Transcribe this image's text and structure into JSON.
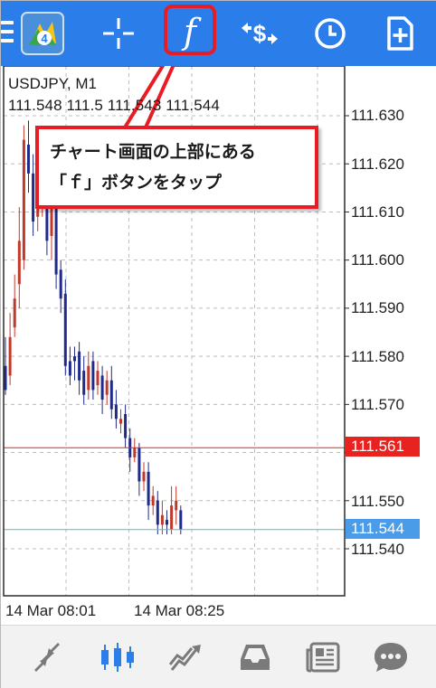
{
  "toolbar": {
    "buttons": [
      {
        "name": "menu-icon"
      },
      {
        "name": "metatrader-logo-icon"
      },
      {
        "name": "crosshair-icon"
      },
      {
        "name": "indicator-f-icon",
        "glyph": "f",
        "highlighted": true
      },
      {
        "name": "trade-icon"
      },
      {
        "name": "history-clock-icon"
      },
      {
        "name": "new-document-icon"
      }
    ],
    "background_color": "#2b7de9"
  },
  "chart": {
    "symbol": "USDJPY, M1",
    "ohlc": "111.548 111.5   111.543 111.544",
    "price_axis": [
      "111.630",
      "111.620",
      "111.610",
      "111.600",
      "111.590",
      "111.580",
      "111.570",
      "111.550",
      "111.540"
    ],
    "bid_tag": {
      "value": "111.561",
      "color": "#e8231f"
    },
    "ask_tag": {
      "value": "111.544",
      "color": "#4a9be8"
    },
    "time_axis": [
      "14 Mar 08:01",
      "14 Mar 08:25"
    ]
  },
  "callout": {
    "line1": "チャート画面の上部にある",
    "line2": "「ｆ」ボタンをタップ",
    "border_color": "#e81c24"
  },
  "chart_data": {
    "type": "candlestick",
    "symbol": "USDJPY",
    "timeframe": "M1",
    "ylim": [
      111.535,
      111.635
    ],
    "candles": [
      {
        "o": 111.578,
        "c": 111.573,
        "h": 111.584,
        "l": 111.572
      },
      {
        "o": 111.576,
        "c": 111.584,
        "h": 111.589,
        "l": 111.574
      },
      {
        "o": 111.586,
        "c": 111.592,
        "h": 111.597,
        "l": 111.584
      },
      {
        "o": 111.595,
        "c": 111.604,
        "h": 111.611,
        "l": 111.59
      },
      {
        "o": 111.6,
        "c": 111.625,
        "h": 111.628,
        "l": 111.598
      },
      {
        "o": 111.624,
        "c": 111.618,
        "h": 111.629,
        "l": 111.614
      },
      {
        "o": 111.618,
        "c": 111.608,
        "h": 111.622,
        "l": 111.605
      },
      {
        "o": 111.609,
        "c": 111.611,
        "h": 111.616,
        "l": 111.606
      },
      {
        "o": 111.612,
        "c": 111.614,
        "h": 111.618,
        "l": 111.609
      },
      {
        "o": 111.614,
        "c": 111.604,
        "h": 111.618,
        "l": 111.601
      },
      {
        "o": 111.605,
        "c": 111.612,
        "h": 111.615,
        "l": 111.6
      },
      {
        "o": 111.613,
        "c": 111.597,
        "h": 111.616,
        "l": 111.594
      },
      {
        "o": 111.598,
        "c": 111.592,
        "h": 111.6,
        "l": 111.589
      },
      {
        "o": 111.593,
        "c": 111.578,
        "h": 111.596,
        "l": 111.576
      },
      {
        "o": 111.579,
        "c": 111.576,
        "h": 111.582,
        "l": 111.574
      },
      {
        "o": 111.58,
        "c": 111.579,
        "h": 111.582,
        "l": 111.575
      },
      {
        "o": 111.581,
        "c": 111.575,
        "h": 111.583,
        "l": 111.572
      },
      {
        "o": 111.577,
        "c": 111.572,
        "h": 111.58,
        "l": 111.57
      },
      {
        "o": 111.573,
        "c": 111.578,
        "h": 111.581,
        "l": 111.571
      },
      {
        "o": 111.579,
        "c": 111.573,
        "h": 111.581,
        "l": 111.571
      },
      {
        "o": 111.574,
        "c": 111.577,
        "h": 111.579,
        "l": 111.572
      },
      {
        "o": 111.576,
        "c": 111.571,
        "h": 111.578,
        "l": 111.568
      },
      {
        "o": 111.572,
        "c": 111.575,
        "h": 111.577,
        "l": 111.57
      },
      {
        "o": 111.575,
        "c": 111.569,
        "h": 111.578,
        "l": 111.567
      },
      {
        "o": 111.57,
        "c": 111.567,
        "h": 111.573,
        "l": 111.565
      },
      {
        "o": 111.566,
        "c": 111.567,
        "h": 111.569,
        "l": 111.564
      },
      {
        "o": 111.568,
        "c": 111.563,
        "h": 111.57,
        "l": 111.561
      },
      {
        "o": 111.563,
        "c": 111.559,
        "h": 111.565,
        "l": 111.556
      },
      {
        "o": 111.559,
        "c": 111.561,
        "h": 111.563,
        "l": 111.558
      },
      {
        "o": 111.561,
        "c": 111.554,
        "h": 111.562,
        "l": 111.551
      },
      {
        "o": 111.554,
        "c": 111.556,
        "h": 111.558,
        "l": 111.552
      },
      {
        "o": 111.556,
        "c": 111.549,
        "h": 111.558,
        "l": 111.546
      },
      {
        "o": 111.549,
        "c": 111.551,
        "h": 111.553,
        "l": 111.547
      },
      {
        "o": 111.55,
        "c": 111.545,
        "h": 111.552,
        "l": 111.543
      },
      {
        "o": 111.545,
        "c": 111.547,
        "h": 111.55,
        "l": 111.543
      },
      {
        "o": 111.546,
        "c": 111.545,
        "h": 111.548,
        "l": 111.543
      },
      {
        "o": 111.544,
        "c": 111.549,
        "h": 111.553,
        "l": 111.543
      },
      {
        "o": 111.548,
        "c": 111.55,
        "h": 111.553,
        "l": 111.545
      },
      {
        "o": 111.548,
        "c": 111.544,
        "h": 111.549,
        "l": 111.543
      }
    ],
    "bid_line": 111.561,
    "ask_line": 111.544,
    "bull_color": "#c0392b",
    "bear_color": "#1f2a8a",
    "grid": true
  },
  "bottom_nav": {
    "items": [
      {
        "name": "quotes-arrows-icon"
      },
      {
        "name": "chart-candles-icon",
        "active": true
      },
      {
        "name": "trade-lines-icon"
      },
      {
        "name": "history-inbox-icon"
      },
      {
        "name": "news-icon"
      },
      {
        "name": "messages-icon"
      }
    ],
    "active_color": "#2b7de9",
    "inactive_color": "#7a7a7a"
  }
}
